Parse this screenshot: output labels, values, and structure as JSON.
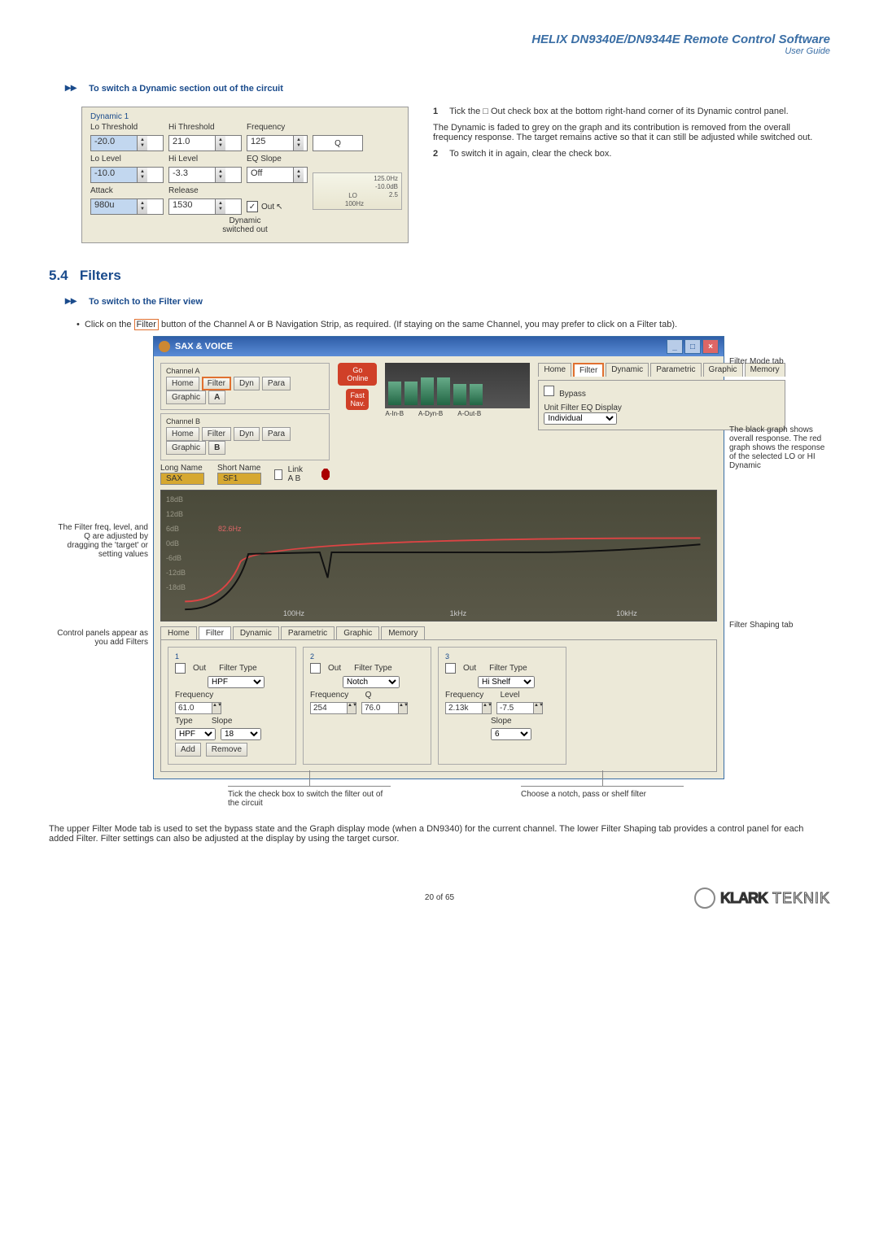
{
  "doc": {
    "title": "HELIX DN9340E/DN9344E Remote Control Software",
    "subtitle": "User Guide"
  },
  "proc1": {
    "heading": "To switch a Dynamic section out of the circuit"
  },
  "dynamic_panel": {
    "title": "Dynamic 1",
    "labels": {
      "lo_thresh": "Lo Threshold",
      "hi_thresh": "Hi Threshold",
      "frequency": "Frequency",
      "lo_level": "Lo Level",
      "hi_level": "Hi Level",
      "eq_slope": "EQ Slope",
      "attack": "Attack",
      "release": "Release"
    },
    "values": {
      "lo_thresh": "-20.0",
      "hi_thresh": "21.0",
      "frequency": "125",
      "q": "Q",
      "lo_level": "-10.0",
      "hi_level": "-3.3",
      "eq_slope": "Off",
      "attack": "980u",
      "release": "1530",
      "out_label": "Out"
    },
    "callout": "Dynamic\nswitched out",
    "graph_labels": {
      "freq": "125.0Hz",
      "db": "-10.0dB",
      "q": "2.5",
      "lo": "LO",
      "hz": "100Hz"
    }
  },
  "steps": {
    "s1_num": "1",
    "s1_text_a": "Tick the ",
    "s1_text_b": "Out",
    "s1_text_c": " check box at the bottom right-hand corner of its Dynamic control panel.",
    "para": "The Dynamic is faded to grey on the graph and its contribution is removed from the overall frequency response.  The target remains active so that it can still be adjusted while switched out.",
    "s2_num": "2",
    "s2_text": "To switch it in again, clear the check box."
  },
  "sec54": {
    "num": "5.4",
    "title": "Filters"
  },
  "proc2": {
    "heading": "To switch to the Filter view",
    "bullet_a": "Click on the ",
    "bullet_b": "Filter",
    "bullet_c": " button of the Channel A or B Navigation Strip, as required.  (If staying on the same Channel, you may prefer to click on a Filter tab)."
  },
  "sax": {
    "title": "SAX & VOICE",
    "chA": "Channel A",
    "chB": "Channel B",
    "btns": [
      "Home",
      "Filter",
      "Dyn",
      "Para",
      "Graphic"
    ],
    "A": "A",
    "B": "B",
    "go": "Go\nOnline",
    "fast": "Fast\nNav.",
    "long_name": "Long Name",
    "short_name": "Short Name",
    "long_val": "SAX",
    "short_val": "SF1",
    "link": "Link A B",
    "bar_labels": [
      "A-In-B",
      "A-Dyn-B",
      "A-Out-B"
    ],
    "right_tabs": [
      "Home",
      "Filter",
      "Dynamic",
      "Parametric",
      "Graphic",
      "Memory"
    ],
    "bypass": "Bypass",
    "ufed": "Unit Filter EQ Display",
    "ufed_val": "Individual",
    "graph": {
      "ylabels": [
        "18dB",
        "12dB",
        "6dB",
        "0dB",
        "-6dB",
        "-12dB",
        "-18dB"
      ],
      "xlabels": [
        "100Hz",
        "1kHz",
        "10kHz"
      ],
      "target": "82.6Hz"
    },
    "lower_tabs": [
      "Home",
      "Filter",
      "Dynamic",
      "Parametric",
      "Graphic",
      "Memory"
    ],
    "filters": {
      "f1": {
        "num": "1",
        "out": "Out",
        "type_lbl": "Filter Type",
        "type": "HPF",
        "freq_lbl": "Frequency",
        "freq": "61.0",
        "type2_lbl": "Type",
        "type2": "HPF",
        "slope_lbl": "Slope",
        "slope": "18"
      },
      "f2": {
        "num": "2",
        "out": "Out",
        "type_lbl": "Filter Type",
        "type": "Notch",
        "freq_lbl": "Frequency",
        "freq": "254",
        "q_lbl": "Q",
        "q": "76.0"
      },
      "f3": {
        "num": "3",
        "out": "Out",
        "type_lbl": "Filter Type",
        "type": "Hi Shelf",
        "freq_lbl": "Frequency",
        "freq": "2.13k",
        "level_lbl": "Level",
        "level": "-7.5",
        "slope_lbl": "Slope",
        "slope": "6"
      },
      "add": "Add",
      "remove": "Remove"
    }
  },
  "callouts": {
    "left1": "The Filter freq, level, and Q are adjusted by dragging the 'target' or setting values",
    "left2": "Control panels appear as you add Filters",
    "right1": "Filter Mode tab",
    "right2": "The black graph shows overall response.  The red graph shows the response of the selected LO or HI Dynamic",
    "right3": "Filter Shaping tab",
    "below1": "Tick the check box to switch the filter out of the circuit",
    "below2": "Choose a notch, pass or shelf filter"
  },
  "bottom_para": "The upper Filter Mode tab is used to set the bypass state and the Graph display mode (when a DN9340) for the current channel.  The lower Filter Shaping tab provides a control panel for each added Filter.  Filter settings can also be adjusted at the display by using the target cursor.",
  "footer": {
    "page": "20 of 65",
    "brand1": "KLARK",
    "brand2": "TEKNIK"
  }
}
